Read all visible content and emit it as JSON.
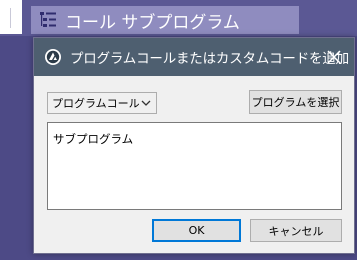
{
  "background": {
    "node_label": "コール サブプログラム",
    "node_icon": "list-icon"
  },
  "dialog": {
    "title": "プログラムコールまたはカスタムコードを追加",
    "title_icon": "app-logo-icon",
    "close_icon": "close-icon",
    "program_select": {
      "selected": "プログラムコール"
    },
    "select_program_label": "プログラムを選択",
    "code_value": "サブプログラム",
    "ok_label": "OK",
    "cancel_label": "キャンセル"
  },
  "colors": {
    "titlebar": "#4e5f70",
    "workspace": "#4d4a86",
    "node": "#8f8cbf",
    "focus_accent": "#0078d7"
  }
}
